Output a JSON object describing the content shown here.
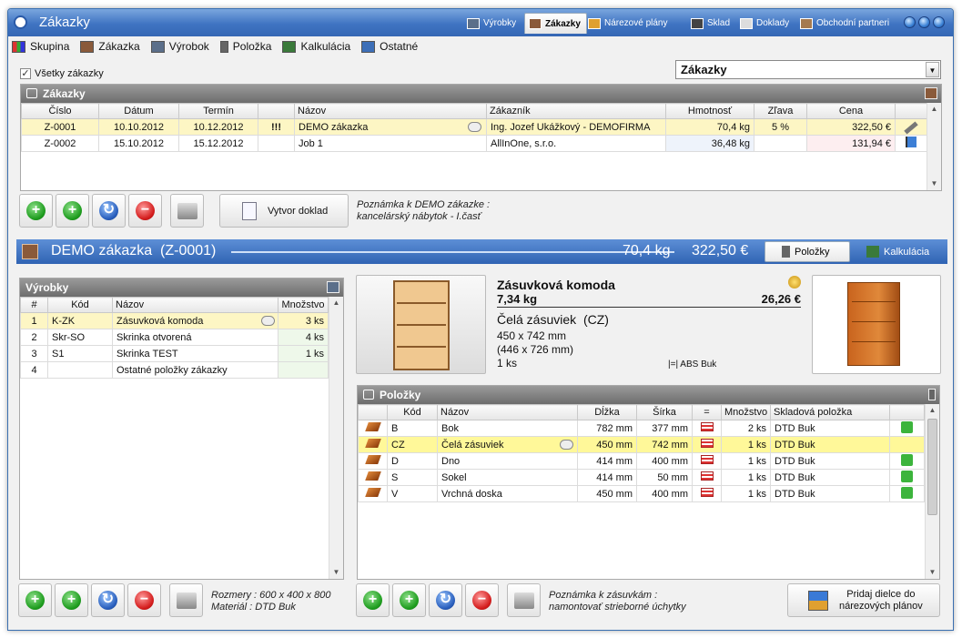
{
  "window": {
    "title": "Zákazky"
  },
  "modules": [
    {
      "label": "Výrobky",
      "icon": "products-icon"
    },
    {
      "label": "Zákazky",
      "icon": "orders-icon",
      "active": true
    },
    {
      "label": "Nárezové plány",
      "icon": "cutting-plans-icon"
    },
    {
      "label": "Sklad",
      "icon": "warehouse-icon"
    },
    {
      "label": "Doklady",
      "icon": "documents-icon"
    },
    {
      "label": "Obchodní partneri",
      "icon": "partners-icon"
    }
  ],
  "toolbar": [
    "Skupina",
    "Zákazka",
    "Výrobok",
    "Položka",
    "Kalkulácia",
    "Ostatné"
  ],
  "filter": {
    "all_orders_label": "Všetky zákazky",
    "combo_value": "Zákazky",
    "combo_arrow": "▼"
  },
  "orders": {
    "title": "Zákazky",
    "columns": [
      "Číslo",
      "Dátum",
      "Termín",
      "",
      "Názov",
      "Zákazník",
      "Hmotnosť",
      "Zľava",
      "Cena"
    ],
    "rows": [
      {
        "cislo": "Z-0001",
        "datum": "10.10.2012",
        "termin": "10.12.2012",
        "priority": "!!!",
        "nazov": "DEMO zákazka",
        "zakaznik": "Ing. Jozef Ukážkový - DEMOFIRMA",
        "hmotnost": "70,4 kg",
        "zlava": "5 %",
        "cena": "322,50 €"
      },
      {
        "cislo": "Z-0002",
        "datum": "15.10.2012",
        "termin": "15.12.2012",
        "priority": "",
        "nazov": "Job 1",
        "zakaznik": "AllInOne, s.r.o.",
        "hmotnost": "36,48 kg",
        "zlava": "",
        "cena": "131,94 €"
      }
    ],
    "create_doc_label": "Vytvor doklad",
    "note_line1": "Poznámka k DEMO zákazke :",
    "note_line2": "kancelárský nábytok - I.časť"
  },
  "band": {
    "title": "DEMO zákazka",
    "code": "(Z-0001)",
    "weight": "70,4 kg",
    "price": "322,50 €",
    "tab_items": "Položky",
    "tab_calc": "Kalkulácia"
  },
  "products": {
    "title": "Výrobky",
    "columns": [
      "#",
      "Kód",
      "Názov",
      "Množstvo"
    ],
    "rows": [
      {
        "n": "1",
        "kod": "K-ZK",
        "nazov": "Zásuvková komoda",
        "mn": "3 ks"
      },
      {
        "n": "2",
        "kod": "Skr-SO",
        "nazov": "Skrinka otvorená",
        "mn": "4 ks"
      },
      {
        "n": "3",
        "kod": "S1",
        "nazov": "Skrinka TEST",
        "mn": "1 ks"
      },
      {
        "n": "4",
        "kod": "",
        "nazov": "Ostatné položky zákazky",
        "mn": ""
      }
    ],
    "note_line1": "Rozmery : 600 x 400 x 800",
    "note_line2": "Materiál : DTD Buk"
  },
  "detail": {
    "name": "Zásuvková komoda",
    "weight": "7,34 kg",
    "price": "26,26 €",
    "part": "Čelá zásuviek",
    "part_code": "(CZ)",
    "dim1": "450 x 742 mm",
    "dim2": "(446 x 726 mm)",
    "qty": "1 ks",
    "edge": "|=|",
    "edge_mat": "ABS Buk"
  },
  "items": {
    "title": "Položky",
    "columns": [
      "",
      "Kód",
      "Názov",
      "Dĺžka",
      "Šírka",
      "=",
      "Množstvo",
      "Skladová položka",
      ""
    ],
    "rows": [
      {
        "kod": "B",
        "nazov": "Bok",
        "dlzka": "782 mm",
        "sirka": "377 mm",
        "mn": "2 ks",
        "sklad": "DTD Buk"
      },
      {
        "kod": "CZ",
        "nazov": "Čelá zásuviek",
        "dlzka": "450 mm",
        "sirka": "742 mm",
        "mn": "1 ks",
        "sklad": "DTD Buk"
      },
      {
        "kod": "D",
        "nazov": "Dno",
        "dlzka": "414 mm",
        "sirka": "400 mm",
        "mn": "1 ks",
        "sklad": "DTD Buk"
      },
      {
        "kod": "S",
        "nazov": "Sokel",
        "dlzka": "414 mm",
        "sirka": "50 mm",
        "mn": "1 ks",
        "sklad": "DTD Buk"
      },
      {
        "kod": "V",
        "nazov": "Vrchná doska",
        "dlzka": "450 mm",
        "sirka": "400 mm",
        "mn": "1 ks",
        "sklad": "DTD Buk"
      }
    ],
    "note_line1": "Poznámka k zásuvkám :",
    "note_line2": "namontovať strieborné úchytky",
    "add_to_plans_line1": "Pridaj dielce do",
    "add_to_plans_line2": "nárezových plánov"
  }
}
